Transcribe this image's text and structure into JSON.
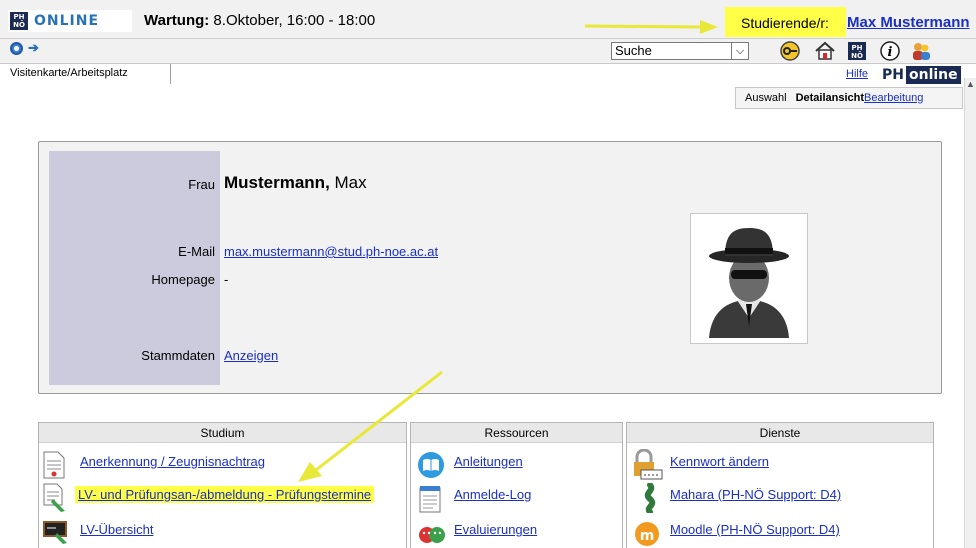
{
  "header": {
    "logo_mark_top": "PH",
    "logo_mark_bottom": "NÖ",
    "logo_text": "ONLINE",
    "maintenance_label": "Wartung:",
    "maintenance_value": " 8.Oktober, 16:00 - 18:00",
    "search_select": "Suche",
    "user_role": "Studierende/r:",
    "user_name": "Max Mustermann"
  },
  "tabbar": {
    "tab_label": "Visitenkarte/Arbeitsplatz",
    "help_link": "Hilfe",
    "brand_ph": "PH",
    "brand_online": "online"
  },
  "view_tabs": {
    "select": "Auswahl",
    "detail": "Detailansicht",
    "edit": "Bearbeitung"
  },
  "card": {
    "salutation": "Frau",
    "last_name": "Mustermann,",
    "first_name": " Max",
    "email_label": "E-Mail",
    "email_value": "max.mustermann@stud.ph-noe.ac.at",
    "homepage_label": "Homepage",
    "homepage_value": "-",
    "master_data_label": "Stammdaten",
    "master_data_link": "Anzeigen"
  },
  "sections": {
    "studium": {
      "title": "Studium",
      "items": [
        "Anerkennung / Zeugnisnachtrag",
        "LV- und Prüfungsan-/abmeldung - Prüfungstermine",
        "LV-Übersicht"
      ]
    },
    "ressourcen": {
      "title": "Ressourcen",
      "items": [
        "Anleitungen",
        "Anmelde-Log",
        "Evaluierungen"
      ]
    },
    "dienste": {
      "title": "Dienste",
      "items": [
        "Kennwort ändern",
        "Mahara (PH-NÖ Support: D4)",
        "Moodle (PH-NÖ Support: D4)"
      ]
    }
  },
  "colors": {
    "highlight": "#ffff47",
    "link": "#1a2fc4",
    "brand": "#1a2a52",
    "label_column": "#cbcbdd",
    "annotation_arrow": "#e8e838"
  }
}
